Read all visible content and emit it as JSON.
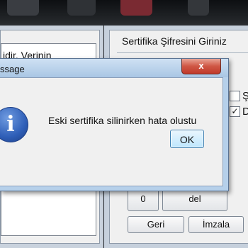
{
  "left_window": {
    "text": "idir. Verinin"
  },
  "right_window": {
    "title": "Sertifika Şifresini Giriniz",
    "checkbox1": {
      "label": "Ş",
      "checked": false
    },
    "checkbox2": {
      "label": "D",
      "checked": true
    },
    "keypad": {
      "zero_label": "0",
      "del_label": "del"
    },
    "back_label": "Geri",
    "sign_label": "İmzala"
  },
  "dialog": {
    "title": "ssage",
    "close_glyph": "x",
    "icon": "info-icon",
    "message": "Eski sertifika silinirken hata olustu",
    "ok_label": "OK"
  },
  "colors": {
    "dialog_frame": "#b6d0ea",
    "close_button": "#c0392b",
    "info_icon": "#2f5fb8",
    "ok_button": "#bee6fd"
  }
}
